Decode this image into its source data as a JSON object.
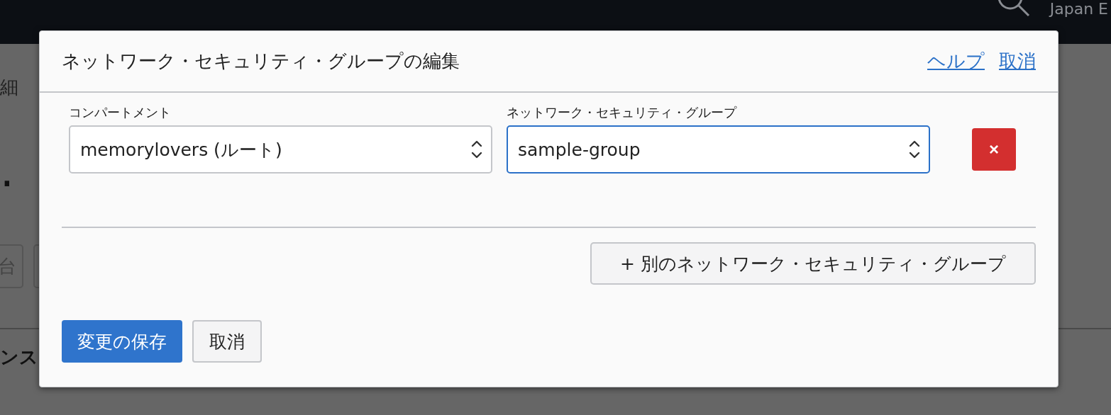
{
  "top_bar": {
    "region": "Japan E"
  },
  "page": {
    "breadcrumb": "細",
    "heading": ".",
    "buttons": [
      {
        "label": "台"
      }
    ],
    "section": "ンス"
  },
  "dialog": {
    "title": "ネットワーク・セキュリティ・グループの編集",
    "links": [
      "ヘルプ",
      "取消"
    ],
    "rows": [
      {
        "compartment": {
          "label": "コンパートメント",
          "value": "memorylovers (ルート)",
          "focused": false
        },
        "group": {
          "label": "ネットワーク・セキュリティ・グループ",
          "value": "sample-group",
          "focused": true
        },
        "remove": "×"
      }
    ],
    "add_button": "+ 別のネットワーク・セキュリティ・グループ",
    "footer_buttons": [
      {
        "label": "変更の保存",
        "kind": "primary"
      },
      {
        "label": "取消",
        "kind": "secondary"
      }
    ]
  }
}
